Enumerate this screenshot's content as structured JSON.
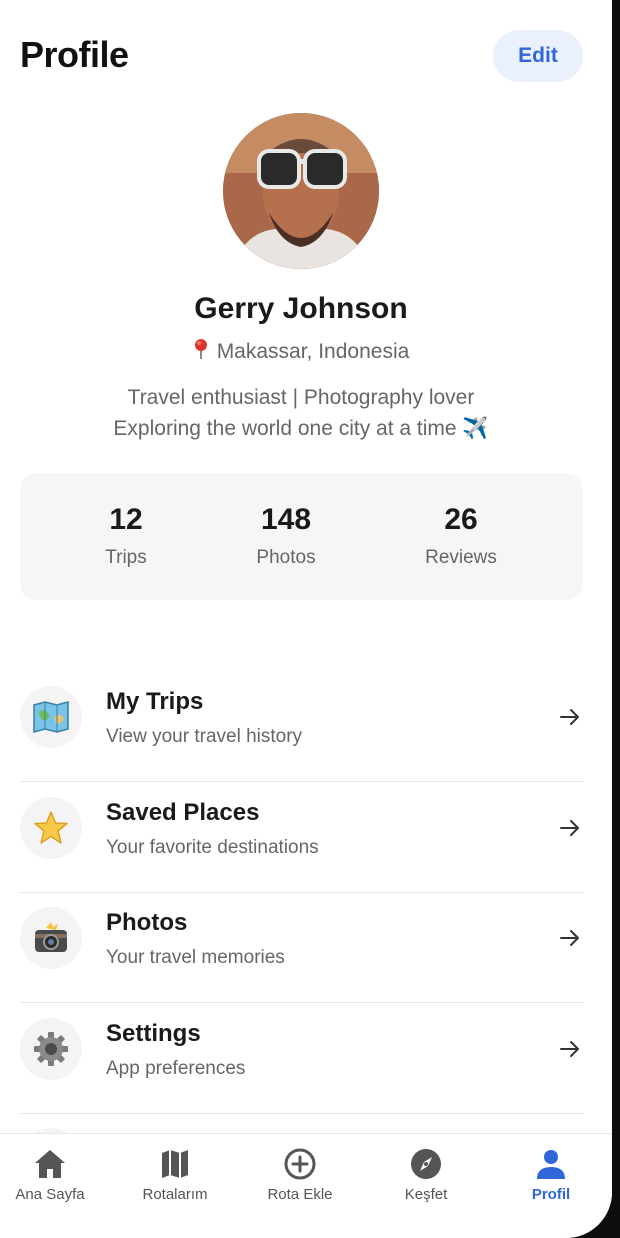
{
  "header": {
    "title": "Profile",
    "edit_label": "Edit"
  },
  "profile": {
    "name": "Gerry Johnson",
    "location": "Makassar, Indonesia",
    "bio_line1": "Travel enthusiast | Photography lover",
    "bio_line2": "Exploring the world one city at a time ✈️"
  },
  "stats": [
    {
      "value": "12",
      "label": "Trips"
    },
    {
      "value": "148",
      "label": "Photos"
    },
    {
      "value": "26",
      "label": "Reviews"
    }
  ],
  "menu": [
    {
      "icon": "map-icon",
      "title": "My Trips",
      "subtitle": "View your travel history"
    },
    {
      "icon": "star-icon",
      "title": "Saved Places",
      "subtitle": "Your favorite destinations"
    },
    {
      "icon": "camera-icon",
      "title": "Photos",
      "subtitle": "Your travel memories"
    },
    {
      "icon": "gear-icon",
      "title": "Settings",
      "subtitle": "App preferences"
    }
  ],
  "tabs": [
    {
      "icon": "home-icon",
      "label": "Ana Sayfa"
    },
    {
      "icon": "map-icon",
      "label": "Rotalarım"
    },
    {
      "icon": "plus-circle-icon",
      "label": "Rota Ekle"
    },
    {
      "icon": "compass-icon",
      "label": "Keşfet"
    },
    {
      "icon": "person-icon",
      "label": "Profil",
      "active": true
    }
  ],
  "colors": {
    "accent": "#2f66d8",
    "edit_bg": "#eaf0fc",
    "stats_bg": "#f6f6f6",
    "muted_text": "#666666"
  }
}
